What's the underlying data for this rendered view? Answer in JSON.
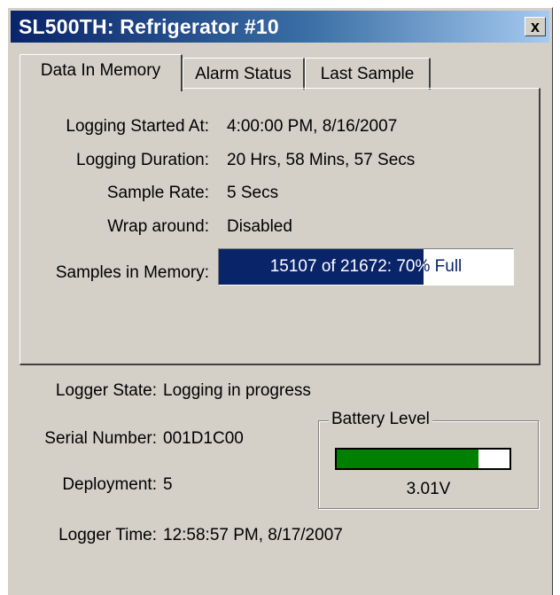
{
  "window": {
    "title": "SL500TH: Refrigerator #10",
    "close_glyph": "x"
  },
  "tabs": [
    {
      "label": "Data In Memory",
      "active": true
    },
    {
      "label": "Alarm Status",
      "active": false
    },
    {
      "label": "Last Sample",
      "active": false
    }
  ],
  "memory": {
    "logging_started_label": "Logging Started At:",
    "logging_started_value": "4:00:00 PM, 8/16/2007",
    "logging_duration_label": "Logging Duration:",
    "logging_duration_value": "20 Hrs, 58 Mins, 57 Secs",
    "sample_rate_label": "Sample Rate:",
    "sample_rate_value": "5 Secs",
    "wrap_label": "Wrap around:",
    "wrap_value": "Disabled",
    "samples_label": "Samples in Memory:",
    "samples_text": "15107 of 21672:  70% Full",
    "samples_fraction": 0.697
  },
  "logger": {
    "state_label": "Logger State:",
    "state_value": "Logging in progress",
    "serial_label": "Serial Number:",
    "serial_value": "001D1C00",
    "deployment_label": "Deployment:",
    "deployment_value": "5",
    "time_label": "Logger Time:",
    "time_value": "12:58:57 PM, 8/17/2007"
  },
  "battery": {
    "legend": "Battery Level",
    "voltage": "3.01V",
    "level_fraction": 0.82,
    "fill_color": "#008000"
  },
  "colors": {
    "face": "#d4d0c8",
    "title_start": "#0a246a",
    "title_end": "#a6caf0",
    "progress": "#0a246a"
  }
}
